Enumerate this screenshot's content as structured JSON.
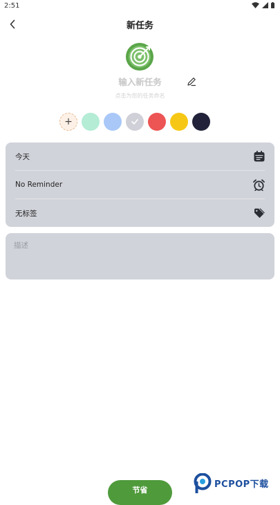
{
  "status_bar": {
    "time": "2:51"
  },
  "header": {
    "title": "新任务"
  },
  "task_name": {
    "placeholder": "输入新任务",
    "hint": "点击为您的任务命名"
  },
  "colors": {
    "options": [
      "#b4ecd6",
      "#a9c8f8",
      "#cfd0d8",
      "#ed5454",
      "#f6c815",
      "#22233a"
    ],
    "selected_index": 2,
    "accent": "#4f9a3b"
  },
  "details": {
    "date_label": "今天",
    "reminder_label": "No Reminder",
    "tag_label": "无标签"
  },
  "description": {
    "placeholder": "描述"
  },
  "actions": {
    "save_label": "节省"
  },
  "watermark": {
    "text": "PCPOP下载"
  }
}
